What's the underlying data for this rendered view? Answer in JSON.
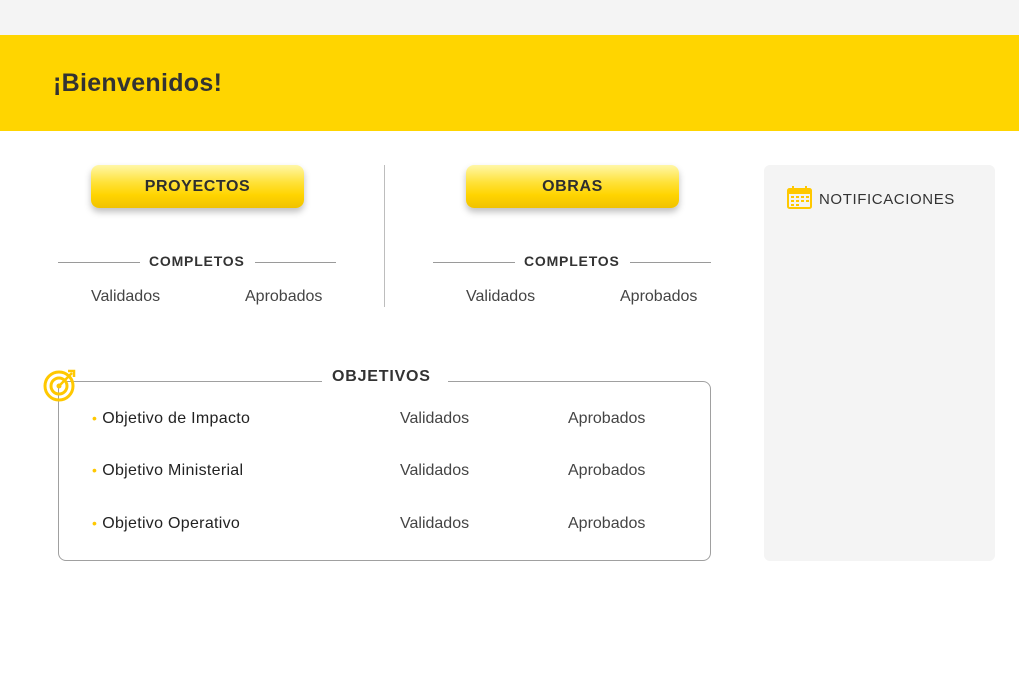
{
  "header": {
    "welcome": "¡Bienvenidos!"
  },
  "proyectos": {
    "button_label": "PROYECTOS",
    "section_title": "COMPLETOS",
    "validated_label": "Validados",
    "approved_label": "Aprobados"
  },
  "obras": {
    "button_label": "OBRAS",
    "section_title": "COMPLETOS",
    "validated_label": "Validados",
    "approved_label": "Aprobados"
  },
  "objetivos": {
    "title": "OBJETIVOS",
    "rows": [
      {
        "label": "Objetivo de Impacto",
        "validated_label": "Validados",
        "approved_label": "Aprobados"
      },
      {
        "label": "Objetivo Ministerial",
        "validated_label": "Validados",
        "approved_label": "Aprobados"
      },
      {
        "label": "Objetivo Operativo",
        "validated_label": "Validados",
        "approved_label": "Aprobados"
      }
    ]
  },
  "notifications": {
    "title": "NOTIFICACIONES",
    "icon": "calendar-icon"
  },
  "icons": {
    "objectives": "target-icon"
  },
  "colors": {
    "accent": "#ffd500",
    "panel": "#f4f4f4",
    "text": "#333333"
  }
}
